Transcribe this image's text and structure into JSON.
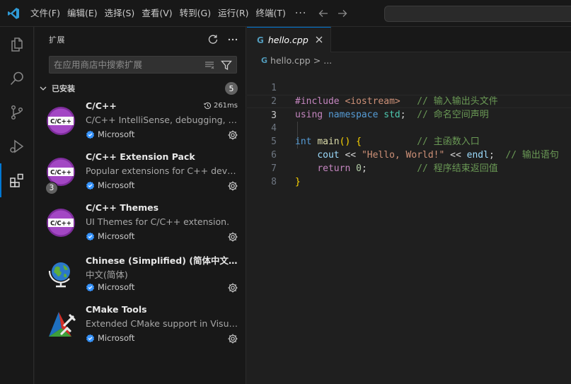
{
  "menu": [
    "文件(F)",
    "编辑(E)",
    "选择(S)",
    "查看(V)",
    "转到(G)",
    "运行(R)",
    "终端(T)"
  ],
  "menu_more": "···",
  "sidebar": {
    "title": "扩展",
    "search_placeholder": "在应用商店中搜索扩展",
    "section_title": "已安装",
    "section_count": "5",
    "extensions": [
      {
        "name": "C/C++",
        "description": "C/C++ IntelliSense, debugging, and code browsing.",
        "publisher": "Microsoft",
        "time": "261ms",
        "icon": "cpp-icon"
      },
      {
        "name": "C/C++ Extension Pack",
        "description": "Popular extensions for C++ development in VS Code.",
        "publisher": "Microsoft",
        "badge": "3",
        "icon": "cpp-icon"
      },
      {
        "name": "C/C++ Themes",
        "description": "UI Themes for C/C++ extension.",
        "publisher": "Microsoft",
        "icon": "cpp-icon"
      },
      {
        "name": "Chinese (Simplified) (简体中文) Language Pack for Visual Studio Code",
        "description": "中文(简体)",
        "publisher": "Microsoft",
        "icon": "globe-icon"
      },
      {
        "name": "CMake Tools",
        "description": "Extended CMake support in Visual Studio Code",
        "publisher": "Microsoft",
        "icon": "cmake-icon"
      }
    ]
  },
  "editor": {
    "tab_label": "hello.cpp",
    "breadcrumb_file": "hello.cpp",
    "breadcrumb_sep": ">",
    "breadcrumb_more": "...",
    "line_numbers": [
      "1",
      "2",
      "3",
      "4",
      "5",
      "6",
      "7",
      "8"
    ],
    "current_line": 3,
    "code": {
      "l1_pp": "#include",
      "l1_inc": "<iostream>",
      "l1_cm": "// 输入输出头文件",
      "l2_using": "using",
      "l2_ns": "namespace",
      "l2_std": "std",
      "l2_semi": ";",
      "l2_cm": "// 命名空间声明",
      "l4_int": "int",
      "l4_main": "main",
      "l4_parens": "()",
      "l4_brace": "{",
      "l4_cm": "// 主函数入口",
      "l5_cout": "cout",
      "l5_op1": "<<",
      "l5_str": "\"Hello, World!\"",
      "l5_op2": "<<",
      "l5_endl": "endl",
      "l5_semi": ";",
      "l5_cm": "// 输出语句",
      "l6_return": "return",
      "l6_zero": "0",
      "l6_semi": ";",
      "l6_cm": "// 程序结束返回值",
      "l7_brace": "}"
    }
  },
  "colors": {
    "accent": "#0078d4",
    "cpp_purple": "#8a2be2",
    "verified": "#3794ff"
  }
}
